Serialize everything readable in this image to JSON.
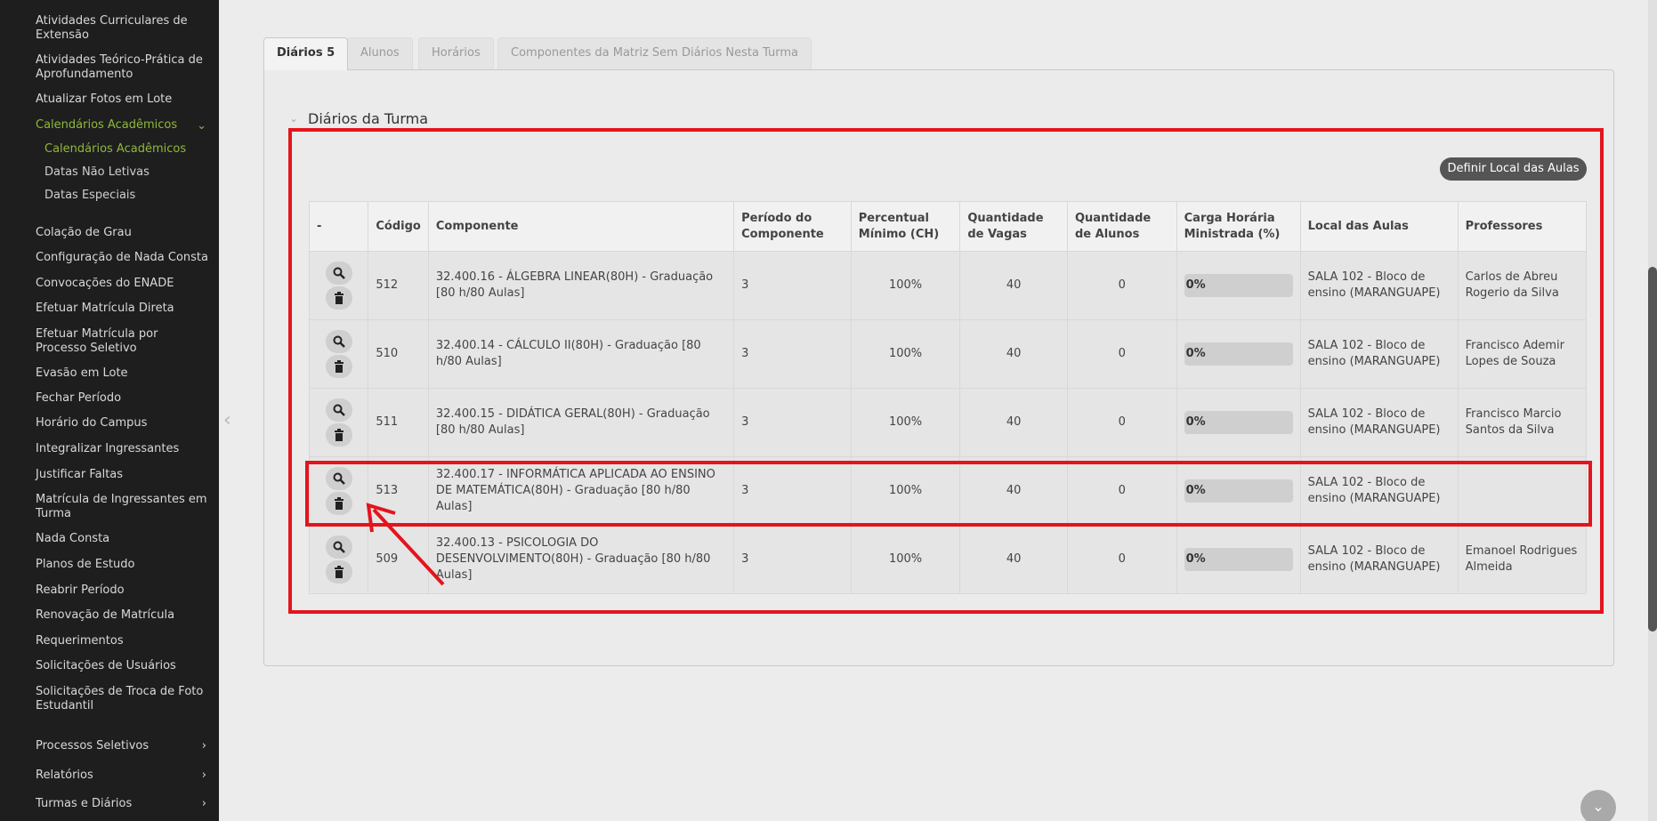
{
  "sidebar": {
    "items": [
      {
        "label": "Atividades Curriculares de Extensão"
      },
      {
        "label": "Atividades Teórico-Prática de Aprofundamento"
      },
      {
        "label": "Atualizar Fotos em Lote"
      },
      {
        "label": "Calendários Acadêmicos"
      },
      {
        "label": "Calendários Acadêmicos"
      },
      {
        "label": "Datas Não Letivas"
      },
      {
        "label": "Datas Especiais"
      },
      {
        "label": "Colação de Grau"
      },
      {
        "label": "Configuração de Nada Consta"
      },
      {
        "label": "Convocações do ENADE"
      },
      {
        "label": "Efetuar Matrícula Direta"
      },
      {
        "label": "Efetuar Matrícula por Processo Seletivo"
      },
      {
        "label": "Evasão em Lote"
      },
      {
        "label": "Fechar Período"
      },
      {
        "label": "Horário do Campus"
      },
      {
        "label": "Integralizar Ingressantes"
      },
      {
        "label": "Justificar Faltas"
      },
      {
        "label": "Matrícula de Ingressantes em Turma"
      },
      {
        "label": "Nada Consta"
      },
      {
        "label": "Planos de Estudo"
      },
      {
        "label": "Reabrir Período"
      },
      {
        "label": "Renovação de Matrícula"
      },
      {
        "label": "Requerimentos"
      },
      {
        "label": "Solicitações de Usuários"
      },
      {
        "label": "Solicitações de Troca de Foto Estudantil"
      },
      {
        "label": "Processos Seletivos"
      },
      {
        "label": "Relatórios"
      },
      {
        "label": "Turmas e Diários"
      }
    ]
  },
  "tabs": [
    {
      "label": "Diários 5"
    },
    {
      "label": "Alunos"
    },
    {
      "label": "Horários"
    },
    {
      "label": "Componentes da Matriz Sem Diários Nesta Turma"
    }
  ],
  "section": {
    "title": "Diários da Turma"
  },
  "define_button": "Definir Local das Aulas",
  "table": {
    "headers": [
      "-",
      "Código",
      "Componente",
      "Período do Componente",
      "Percentual Mínimo (CH)",
      "Quantidade de Vagas",
      "Quantidade de Alunos",
      "Carga Horária Ministrada (%)",
      "Local das Aulas",
      "Professores"
    ],
    "rows": [
      {
        "codigo": "512",
        "componente": "32.400.16 - ÁLGEBRA LINEAR(80H) - Graduação [80 h/80 Aulas]",
        "periodo": "3",
        "percentual": "100%",
        "vagas": "40",
        "alunos": "0",
        "carga": "0%",
        "local": "SALA 102 - Bloco de ensino (MARANGUAPE)",
        "professores": "Carlos de Abreu Rogerio da Silva"
      },
      {
        "codigo": "510",
        "componente": "32.400.14 - CÁLCULO II(80H) - Graduação [80 h/80 Aulas]",
        "periodo": "3",
        "percentual": "100%",
        "vagas": "40",
        "alunos": "0",
        "carga": "0%",
        "local": "SALA 102 - Bloco de ensino (MARANGUAPE)",
        "professores": "Francisco Ademir Lopes de Souza"
      },
      {
        "codigo": "511",
        "componente": "32.400.15 - DIDÁTICA GERAL(80H) - Graduação [80 h/80 Aulas]",
        "periodo": "3",
        "percentual": "100%",
        "vagas": "40",
        "alunos": "0",
        "carga": "0%",
        "local": "SALA 102 - Bloco de ensino (MARANGUAPE)",
        "professores": "Francisco Marcio Santos da Silva"
      },
      {
        "codigo": "513",
        "componente": "32.400.17 - INFORMÁTICA APLICADA AO ENSINO DE MATEMÁTICA(80H) - Graduação [80 h/80 Aulas]",
        "periodo": "3",
        "percentual": "100%",
        "vagas": "40",
        "alunos": "0",
        "carga": "0%",
        "local": "SALA 102 - Bloco de ensino (MARANGUAPE)",
        "professores": ""
      },
      {
        "codigo": "509",
        "componente": "32.400.13 - PSICOLOGIA DO DESENVOLVIMENTO(80H) - Graduação [80 h/80 Aulas]",
        "periodo": "3",
        "percentual": "100%",
        "vagas": "40",
        "alunos": "0",
        "carga": "0%",
        "local": "SALA 102 - Bloco de ensino (MARANGUAPE)",
        "professores": "Emanoel Rodrigues Almeida"
      }
    ]
  },
  "colors": {
    "accent_green": "#8fb93a",
    "link_green": "#4e9a58",
    "annotation_red": "#e4141c",
    "sidebar_bg": "#1e1e1e"
  }
}
